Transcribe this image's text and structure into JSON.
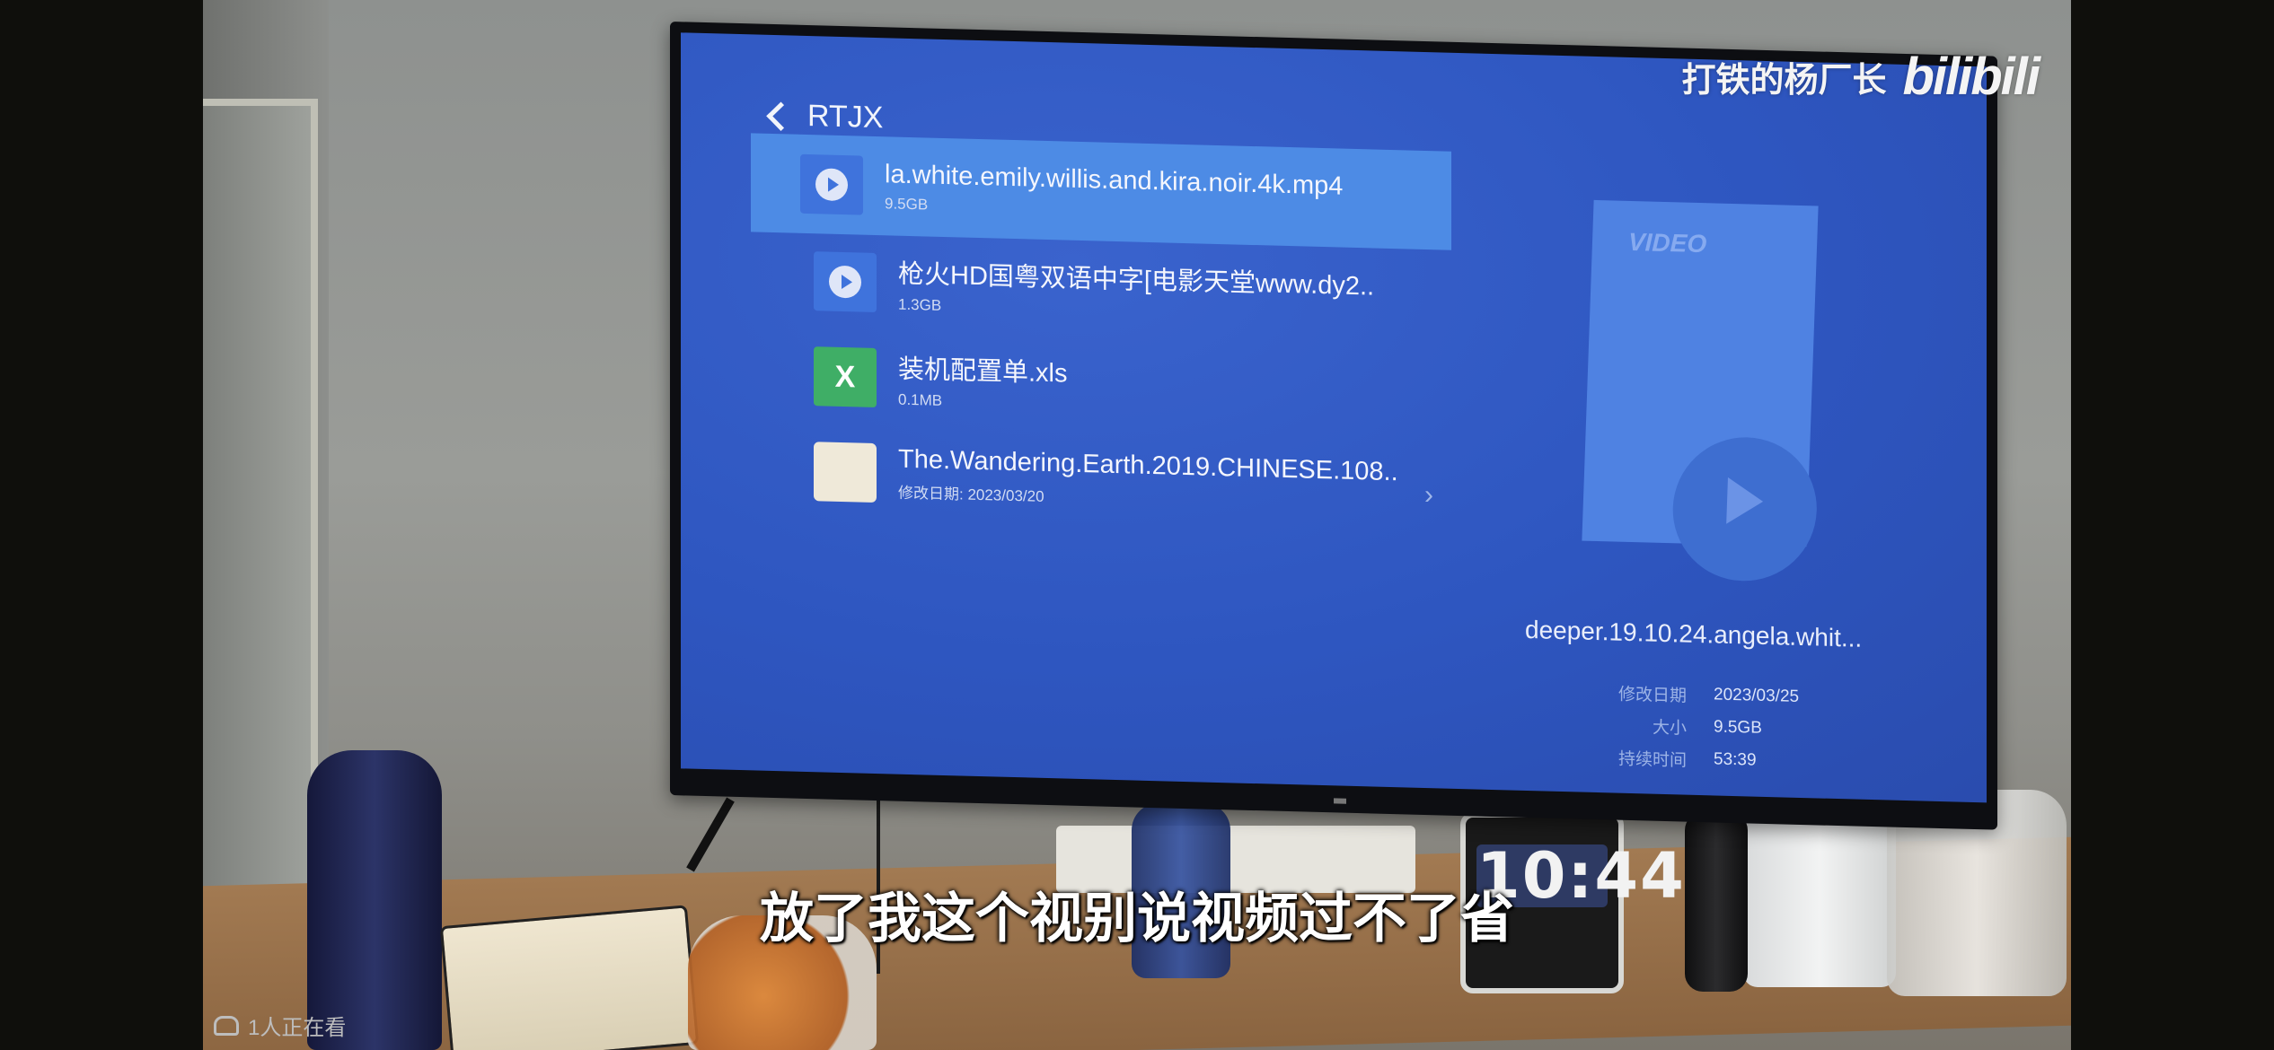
{
  "watermark": {
    "uploader": "打铁的杨厂长",
    "logo_text": "bilibili"
  },
  "file_browser": {
    "folder_title": "RTJX",
    "files": [
      {
        "name": "la.white.emily.willis.and.kira.noir.4k.mp4",
        "sub": "9.5GB",
        "icon": "video-file-icon",
        "selected": true
      },
      {
        "name": "枪火HD国粤双语中字[电影天堂www.dy2..",
        "sub": "1.3GB",
        "icon": "video-file-icon",
        "selected": false
      },
      {
        "name": "装机配置单.xls",
        "sub": "0.1MB",
        "icon": "excel-file-icon",
        "icon_letter": "X",
        "selected": false
      },
      {
        "name": "The.Wandering.Earth.2019.CHINESE.108..",
        "sub": "修改日期: 2023/03/20",
        "icon": "folder-icon",
        "selected": false,
        "has_chevron": true,
        "chevron": "›"
      }
    ],
    "preview": {
      "badge": "VIDEO",
      "file_name": "deeper.19.10.24.angela.whit...",
      "details": [
        {
          "label": "修改日期",
          "value": "2023/03/25"
        },
        {
          "label": "大小",
          "value": "9.5GB"
        },
        {
          "label": "持续时间",
          "value": "53:39"
        }
      ]
    }
  },
  "clock": {
    "time": "10:44"
  },
  "subtitle": "放了我这个视别说视频过不了省",
  "viewers": "1人正在看",
  "colors": {
    "screen_blue": "#2e56c0",
    "selected_row": "#4d8be5",
    "excel_green": "#3fae66"
  }
}
